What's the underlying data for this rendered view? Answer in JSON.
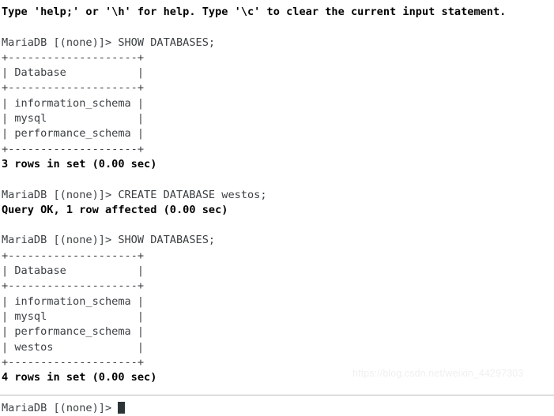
{
  "terminal": {
    "app": "MariaDB monitor",
    "prompt": "MariaDB [(none)]> ",
    "cursor": "block-cursor",
    "colors": {
      "background": "#ffffff",
      "regular_text": "#3c4043",
      "bold_text": "#000000",
      "cursor": "#2d3436",
      "watermark": "#f0f0f0",
      "bottom_border": "#b8b8b8"
    },
    "lines": [
      {
        "id": "l01",
        "text": "Type 'help;' or '\\h' for help. Type '\\c' to clear the current input statement.",
        "bold": true
      },
      {
        "id": "l02",
        "text": "",
        "bold": false
      },
      {
        "id": "l03",
        "text": "MariaDB [(none)]> SHOW DATABASES;",
        "bold": false
      },
      {
        "id": "l04",
        "text": "+--------------------+",
        "bold": false
      },
      {
        "id": "l05",
        "text": "| Database           |",
        "bold": false
      },
      {
        "id": "l06",
        "text": "+--------------------+",
        "bold": false
      },
      {
        "id": "l07",
        "text": "| information_schema |",
        "bold": false
      },
      {
        "id": "l08",
        "text": "| mysql              |",
        "bold": false
      },
      {
        "id": "l09",
        "text": "| performance_schema |",
        "bold": false
      },
      {
        "id": "l10",
        "text": "+--------------------+",
        "bold": false
      },
      {
        "id": "l11",
        "text": "3 rows in set (0.00 sec)",
        "bold": true
      },
      {
        "id": "l12",
        "text": "",
        "bold": false
      },
      {
        "id": "l13",
        "text": "MariaDB [(none)]> CREATE DATABASE westos;",
        "bold": false
      },
      {
        "id": "l14",
        "text": "Query OK, 1 row affected (0.00 sec)",
        "bold": true
      },
      {
        "id": "l15",
        "text": "",
        "bold": false
      },
      {
        "id": "l16",
        "text": "MariaDB [(none)]> SHOW DATABASES;",
        "bold": false
      },
      {
        "id": "l17",
        "text": "+--------------------+",
        "bold": false
      },
      {
        "id": "l18",
        "text": "| Database           |",
        "bold": false
      },
      {
        "id": "l19",
        "text": "+--------------------+",
        "bold": false
      },
      {
        "id": "l20",
        "text": "| information_schema |",
        "bold": false
      },
      {
        "id": "l21",
        "text": "| mysql              |",
        "bold": false
      },
      {
        "id": "l22",
        "text": "| performance_schema |",
        "bold": false
      },
      {
        "id": "l23",
        "text": "| westos             |",
        "bold": false
      },
      {
        "id": "l24",
        "text": "+--------------------+",
        "bold": false
      },
      {
        "id": "l25",
        "text": "4 rows in set (0.00 sec)",
        "bold": true
      },
      {
        "id": "l26",
        "text": "",
        "bold": false
      }
    ],
    "final_prompt": "MariaDB [(none)]> ",
    "watermark": "https://blog.csdn.net/weixin_44297303"
  }
}
